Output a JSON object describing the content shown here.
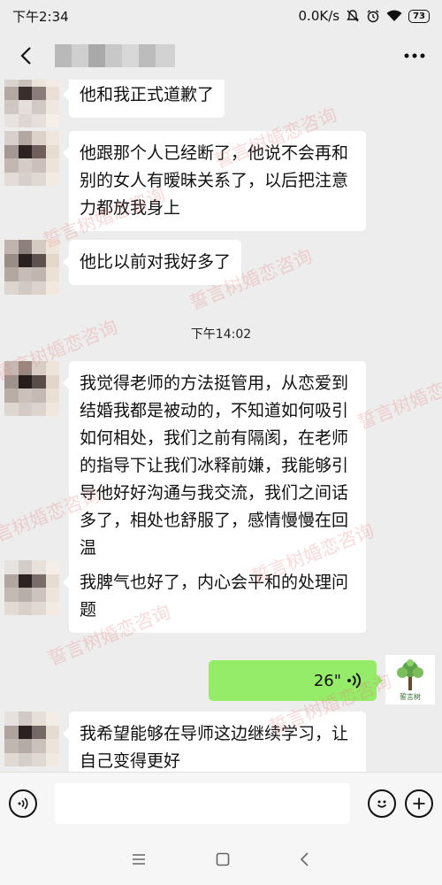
{
  "status_bar": {
    "time": "下午2:34",
    "network_speed": "0.0K/s",
    "battery": "73"
  },
  "nav": {
    "back_icon": "chevron-left-icon",
    "more_icon": "more-dots-icon"
  },
  "messages": [
    {
      "text": "他和我正式道歉了"
    },
    {
      "text": "他跟那个人已经断了，他说不会再和别的女人有暧昧关系了，以后把注意力都放我身上"
    },
    {
      "text": "他比以前对我好多了"
    },
    {
      "text": "我觉得老师的方法挺管用，从恋爱到结婚我都是被动的，不知道如何吸引如何相处，我们之前有隔阂，在老师的指导下让我们冰释前嫌，我能够引导他好好沟通与我交流，我们之间话多了，相处也舒服了，感情慢慢在回温"
    },
    {
      "text": "我脾气也好了，内心会平和的处理问题"
    },
    {
      "text": "我希望能够在导师这边继续学习，让自己变得更好"
    }
  ],
  "time_divider": "下午14:02",
  "voice_message": {
    "duration": "26\"",
    "icon": "voice-wave-icon"
  },
  "my_avatar": {
    "logo_text": "誓言树"
  },
  "watermark": "誓言树婚恋咨询",
  "colors": {
    "background": "#ededed",
    "voice_bubble": "#95ec69",
    "bubble": "#ffffff",
    "watermark": "#eb7878"
  },
  "input_bar": {
    "voice_icon": "voice-input-icon",
    "emoji_icon": "emoji-icon",
    "plus_icon": "plus-icon"
  },
  "system_nav": {
    "menu_icon": "menu-icon",
    "home_icon": "home-icon",
    "back_icon": "back-icon"
  }
}
